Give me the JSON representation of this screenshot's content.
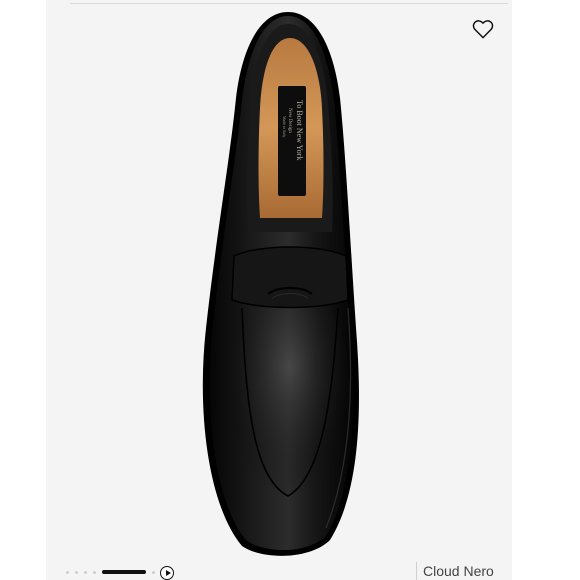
{
  "product": {
    "insole_brand": "To Boot New York",
    "insole_line": "New Design",
    "insole_origin": "Made in Italy",
    "color_name": "Cloud Nero"
  },
  "gallery": {
    "slide_count": 7,
    "active_slide": 5
  },
  "icons": {
    "favorite": "heart-outline-icon",
    "video": "play-circle-icon"
  },
  "colors": {
    "background": "#f4f4f4",
    "leather": "#111111",
    "insole": "#c98a50"
  }
}
